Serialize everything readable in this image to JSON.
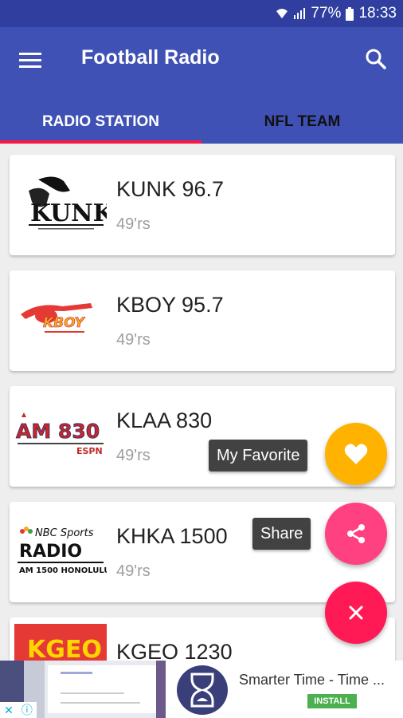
{
  "status_bar": {
    "battery": "77%",
    "time": "18:33"
  },
  "app_bar": {
    "title": "Football Radio"
  },
  "tabs": [
    {
      "label": "RADIO STATION",
      "active": true
    },
    {
      "label": "NFL TEAM",
      "active": false
    }
  ],
  "stations": [
    {
      "name": "KUNK 96.7",
      "team": "49'rs",
      "logo_text": "KUNK"
    },
    {
      "name": "KBOY 95.7",
      "team": "49'rs",
      "logo_text": "KBOY"
    },
    {
      "name": "KLAA 830",
      "team": "49'rs",
      "logo_text": "AM 830",
      "logo_sub": "ESPN"
    },
    {
      "name": "KHKA 1500",
      "team": "49'rs",
      "logo_text": "NBC Sports",
      "logo_mid": "RADIO",
      "logo_sub": "AM 1500 HONOLULU"
    },
    {
      "name": "KGEO 1230",
      "team": "",
      "logo_text": "KGEO"
    }
  ],
  "fab_menu": {
    "favorite_label": "My Favorite",
    "share_label": "Share"
  },
  "ad": {
    "title": "Smarter Time - Time ...",
    "install_label": "INSTALL"
  },
  "colors": {
    "primary": "#3f51b5",
    "primary_dark": "#303f9f",
    "accent": "#ff1744",
    "favorite_fab": "#ffb300",
    "share_fab": "#ff4081"
  }
}
